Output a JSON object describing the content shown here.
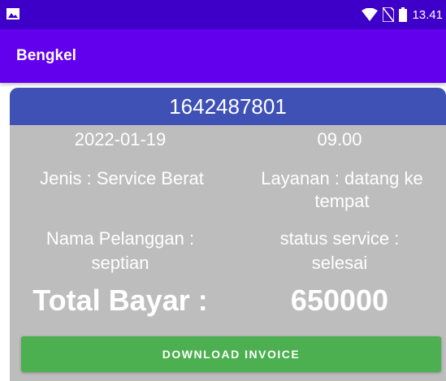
{
  "status_bar": {
    "time": "13.41",
    "icons": [
      "image-icon",
      "wifi-icon",
      "no-sim-icon",
      "battery-icon"
    ]
  },
  "app_bar": {
    "title": "Bengkel"
  },
  "card": {
    "id": "1642487801",
    "date": "2022-01-19",
    "time": "09.00",
    "jenis_line": "Jenis : Service Berat",
    "layanan_line1": "Layanan : datang ke",
    "layanan_line2": "tempat",
    "pelanggan_line1": "Nama Pelanggan :",
    "pelanggan_line2": "septian",
    "status_line1": "status service :",
    "status_line2": "selesai",
    "total_label": "Total Bayar :",
    "total_value": "650000",
    "download_label": "DOWNLOAD INVOICE"
  },
  "colors": {
    "status_bar": "#3e00c8",
    "app_bar": "#6200ee",
    "card_header": "#3f51b5",
    "card_body": "#bdbdbd",
    "button": "#4caf50"
  }
}
